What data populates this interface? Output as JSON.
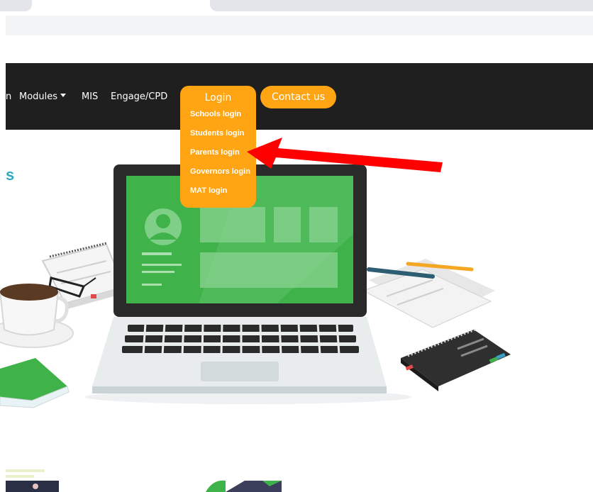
{
  "nav": {
    "partial_item": "n",
    "modules_label": "Modules",
    "mis_label": "MIS",
    "engage_label": "Engage/CPD",
    "contact_label": "Contact us"
  },
  "login_menu": {
    "title": "Login",
    "items": [
      {
        "label": "Schools login"
      },
      {
        "label": "Students login"
      },
      {
        "label": "Parents login"
      },
      {
        "label": "Governors login"
      },
      {
        "label": "MAT login"
      }
    ]
  },
  "hero": {
    "partial_heading": "s"
  },
  "colors": {
    "accent": "#ffa412",
    "navbar": "#1f1f1f",
    "arrow": "#ff0000",
    "screen": "#3fb24a"
  }
}
